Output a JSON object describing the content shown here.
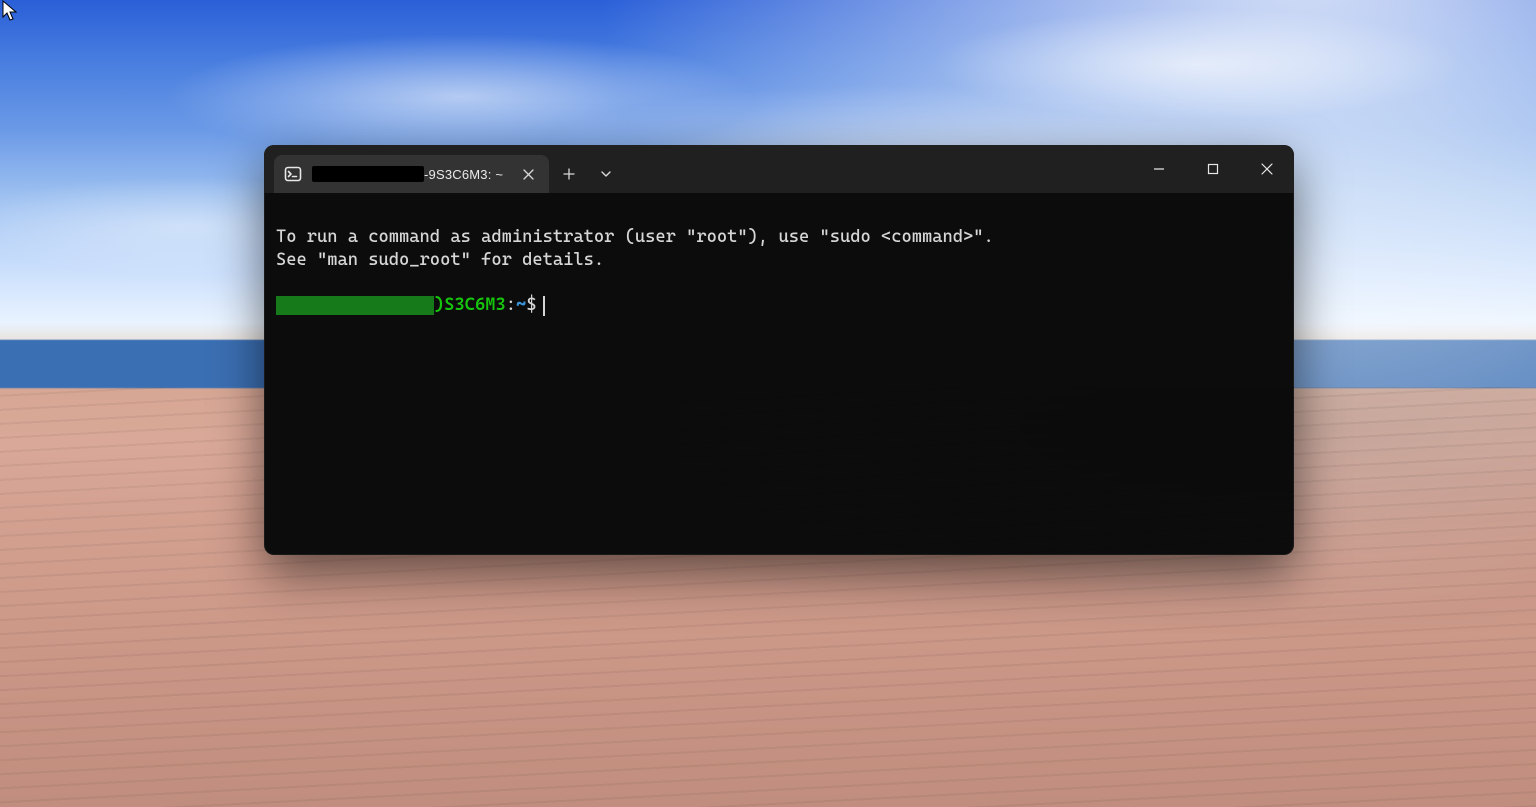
{
  "tab": {
    "title_suffix": "-9S3C6M3: ~",
    "icon": "terminal-icon"
  },
  "terminal": {
    "motd_line1": "To run a command as administrator (user \"root\"), use \"sudo <command>\".",
    "motd_line2": "See \"man sudo_root\" for details.",
    "prompt_host_suffix": ")S3C6M3",
    "prompt_sep": ":",
    "prompt_path": "~",
    "prompt_symbol": "$"
  }
}
